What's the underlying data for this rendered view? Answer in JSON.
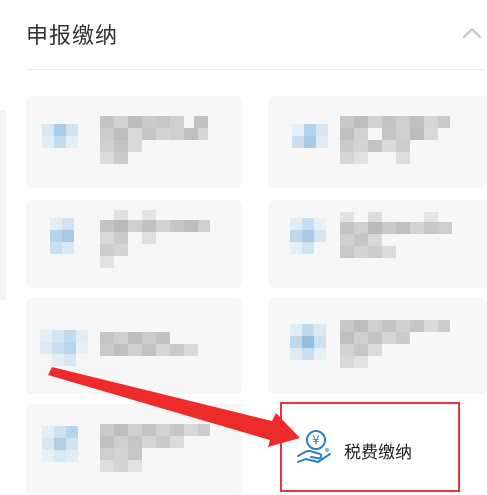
{
  "section": {
    "title": "申报缴纳",
    "collapse_icon": "chevron-up-icon"
  },
  "highlighted_item": {
    "label": "税费缴纳",
    "icon": "coin-in-hand-icon",
    "icon_symbol": "¥",
    "box_color": "#e0383d",
    "icon_color": "#2f7fc8"
  },
  "annotation": {
    "arrow_color": "#ee2b2b"
  },
  "colors": {
    "placeholder_icon": "#bcd9ee",
    "placeholder_text": "#c8c8c8"
  }
}
